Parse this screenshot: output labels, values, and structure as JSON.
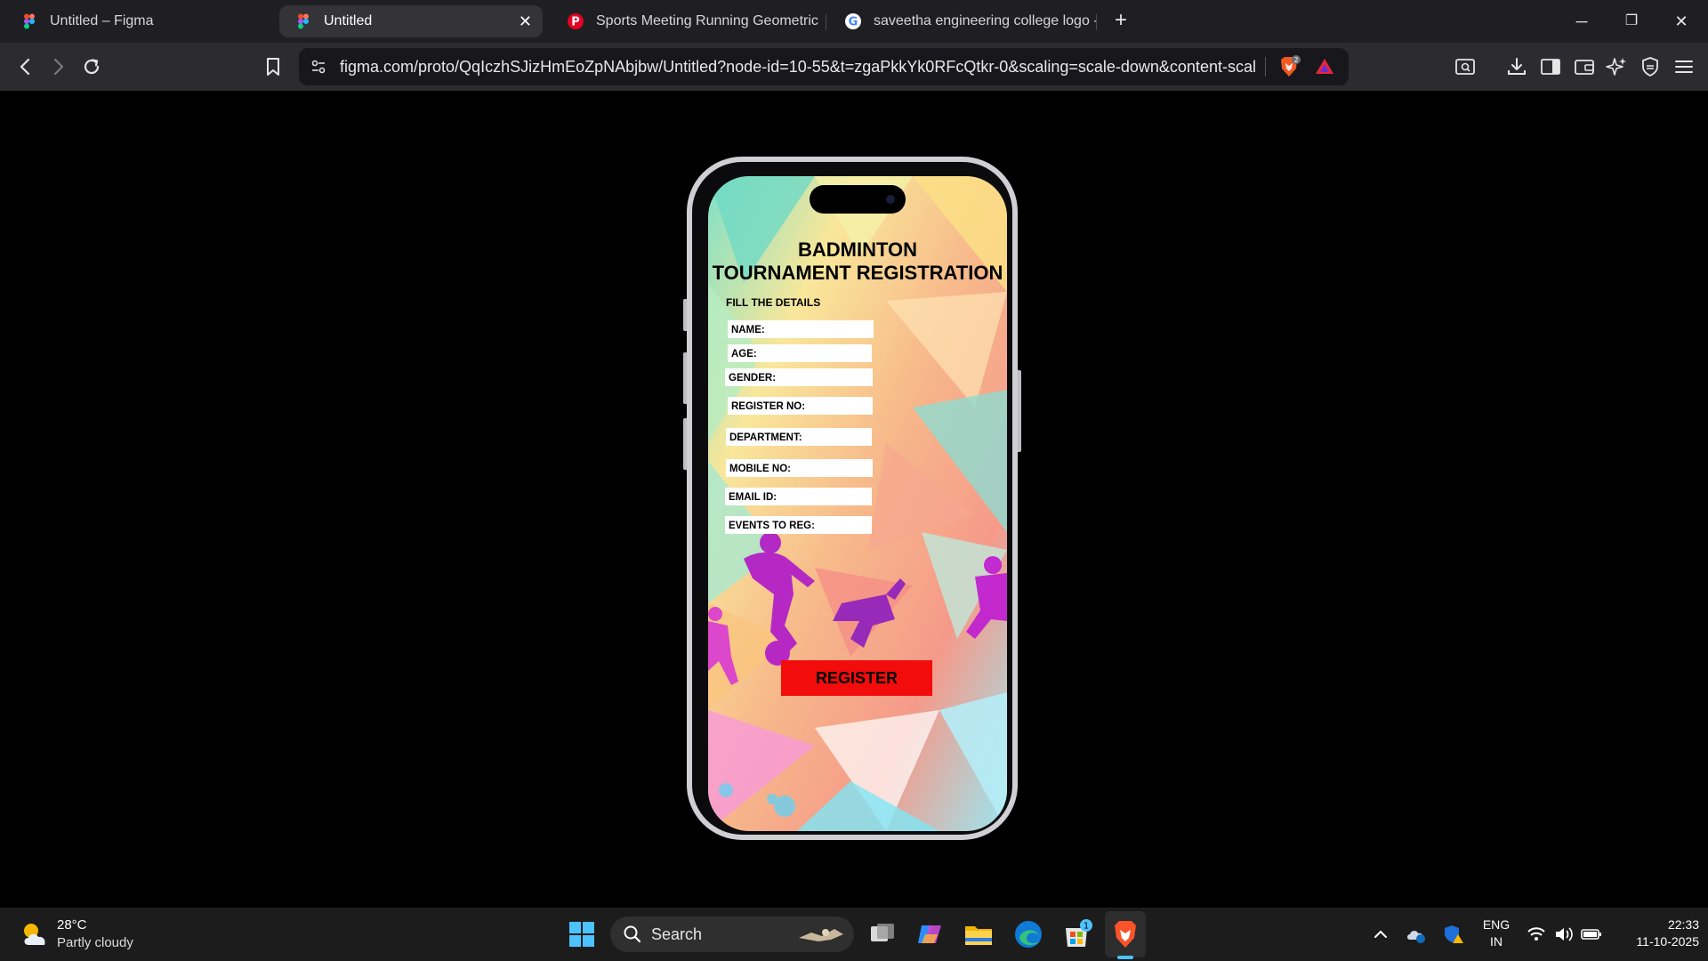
{
  "browser": {
    "tabs": [
      {
        "title": "Untitled – Figma",
        "active": false
      },
      {
        "title": "Untitled",
        "active": true
      },
      {
        "title": "Sports Meeting Running Geometric V",
        "active": false
      },
      {
        "title": "saveetha engineering college logo - (",
        "active": false
      }
    ],
    "url": "figma.com/proto/QqIczhSJizHmEoZpNAbjbw/Untitled?node-id=10-55&t=zgaPkkYk0RFcQtkr-0&scaling=scale-down&content-scal...",
    "shield_badge": "2"
  },
  "form": {
    "title_line1": "BADMINTON",
    "title_line2": "TOURNAMENT REGISTRATION",
    "subtitle": "FILL THE DETAILS",
    "fields": [
      {
        "label": "NAME:"
      },
      {
        "label": "AGE:"
      },
      {
        "label": "GENDER:"
      },
      {
        "label": "REGISTER NO:"
      },
      {
        "label": "DEPARTMENT:"
      },
      {
        "label": "MOBILE NO:"
      },
      {
        "label": "EMAIL ID:"
      },
      {
        "label": "EVENTS TO REG:"
      }
    ],
    "register_label": "REGISTER",
    "colors": {
      "button": "#f20c0c",
      "field": "#ffffff",
      "text": "#000000"
    }
  },
  "taskbar": {
    "weather_temp": "28°C",
    "weather_desc": "Partly cloudy",
    "search_label": "Search",
    "store_badge": "1",
    "lang_line1": "ENG",
    "lang_line2": "IN",
    "time": "22:33",
    "date": "11-10-2025"
  }
}
